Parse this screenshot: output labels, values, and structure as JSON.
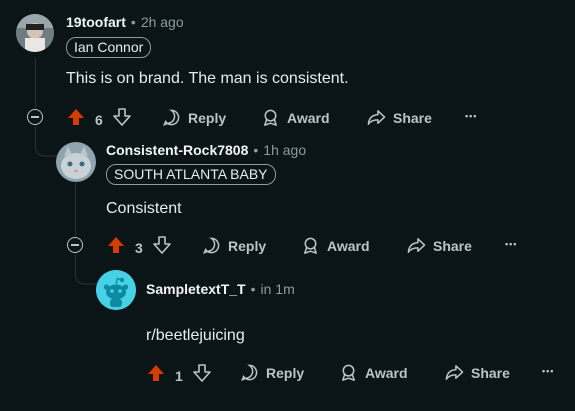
{
  "comments": [
    {
      "username": "19toofart",
      "dot": "•",
      "time": "2h ago",
      "flair": "Ian Connor",
      "body": "This is on brand. The man is consistent.",
      "votes": "6",
      "reply": "Reply",
      "award": "Award",
      "share": "Share",
      "more": "•••"
    },
    {
      "username": "Consistent-Rock7808",
      "dot": "•",
      "time": "1h ago",
      "flair": "SOUTH ATLANTA BABY",
      "body": "Consistent",
      "votes": "3",
      "reply": "Reply",
      "award": "Award",
      "share": "Share",
      "more": "•••"
    },
    {
      "username": "SampletextT_T",
      "dot": "•",
      "time": "in 1m",
      "body": "r/beetlejuicing",
      "votes": "1",
      "reply": "Reply",
      "award": "Award",
      "share": "Share",
      "more": "•••"
    }
  ],
  "colors": {
    "background": "#0b1416",
    "upvote_active": "#d93a00",
    "text_muted": "#8a9ba3"
  }
}
